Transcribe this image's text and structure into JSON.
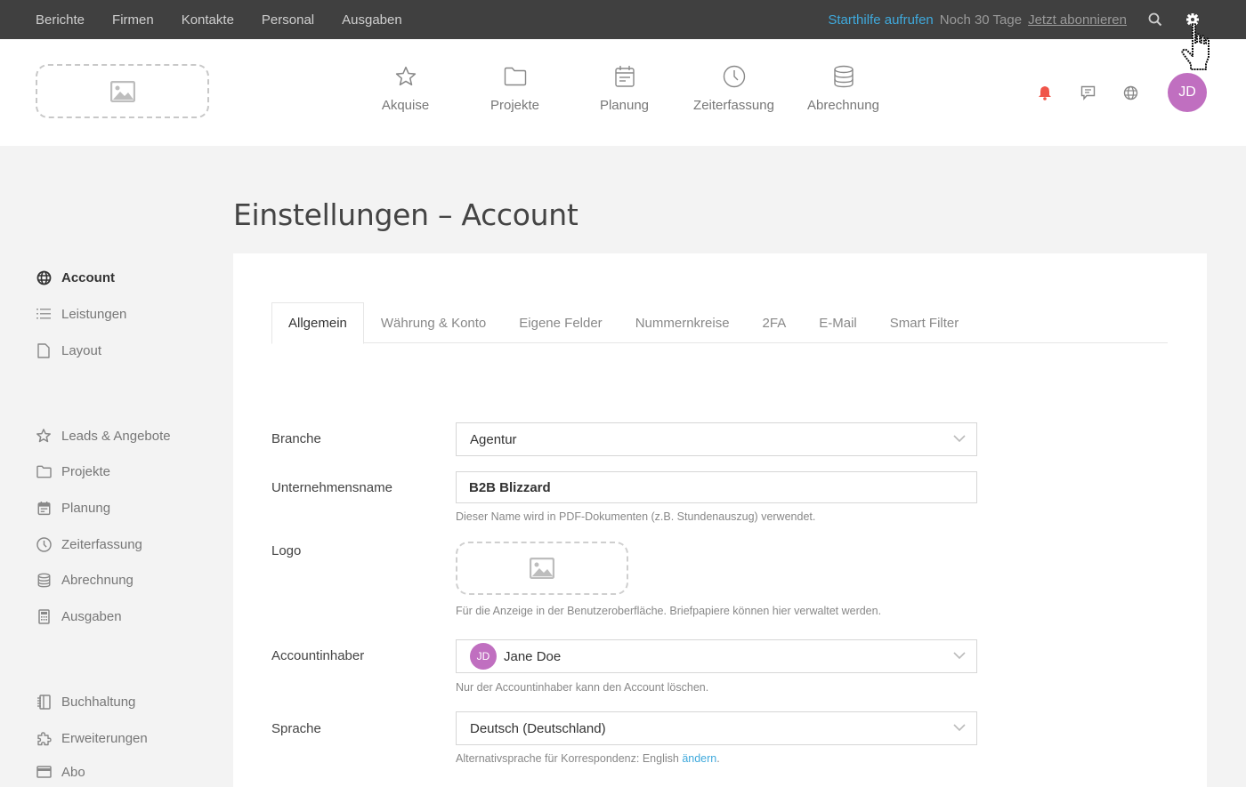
{
  "topbar": {
    "nav": [
      "Berichte",
      "Firmen",
      "Kontakte",
      "Personal",
      "Ausgaben"
    ],
    "help_link": "Starthilfe aufrufen",
    "trial_text": "Noch 30 Tage",
    "subscribe_link": "Jetzt abonnieren",
    "icons": [
      "search-icon",
      "gear-icon"
    ],
    "help_color": "#3fa9dc",
    "background": "#404040"
  },
  "header": {
    "logo_placeholder": "image-icon",
    "nav": [
      {
        "label": "Akquise",
        "icon": "star-icon"
      },
      {
        "label": "Projekte",
        "icon": "folder-icon"
      },
      {
        "label": "Planung",
        "icon": "calendar-icon"
      },
      {
        "label": "Zeiterfassung",
        "icon": "clock-icon"
      },
      {
        "label": "Abrechnung",
        "icon": "database-icon"
      }
    ],
    "icons": [
      "bell-icon",
      "chat-icon",
      "globe-icon"
    ],
    "avatar_initials": "JD",
    "avatar_color": "#c06fc0",
    "bell_color": "#f0554a"
  },
  "page": {
    "title": "Einstellungen – Account"
  },
  "sidebar": {
    "groups": [
      [
        {
          "label": "Account",
          "icon": "globe-icon",
          "active": true
        },
        {
          "label": "Leistungen",
          "icon": "list-icon"
        },
        {
          "label": "Layout",
          "icon": "document-icon"
        }
      ],
      [
        {
          "label": "Leads & Angebote",
          "icon": "star-icon"
        },
        {
          "label": "Projekte",
          "icon": "folder-icon"
        },
        {
          "label": "Planung",
          "icon": "calendar-icon"
        },
        {
          "label": "Zeiterfassung",
          "icon": "clock-icon"
        },
        {
          "label": "Abrechnung",
          "icon": "database-icon"
        },
        {
          "label": "Ausgaben",
          "icon": "calculator-icon"
        }
      ],
      [
        {
          "label": "Buchhaltung",
          "icon": "ledger-icon"
        },
        {
          "label": "Erweiterungen",
          "icon": "puzzle-icon"
        },
        {
          "label": "Abo",
          "icon": "card-icon"
        }
      ]
    ]
  },
  "tabs": [
    {
      "label": "Allgemein",
      "active": true
    },
    {
      "label": "Währung & Konto"
    },
    {
      "label": "Eigene Felder"
    },
    {
      "label": "Nummernkreise"
    },
    {
      "label": "2FA"
    },
    {
      "label": "E-Mail"
    },
    {
      "label": "Smart Filter"
    }
  ],
  "form": {
    "branche": {
      "label": "Branche",
      "value": "Agentur"
    },
    "company": {
      "label": "Unternehmensname",
      "value": "B2B Blizzard",
      "hint": "Dieser Name wird in PDF-Dokumenten (z.B. Stundenauszug) verwendet."
    },
    "logo": {
      "label": "Logo",
      "hint": "Für die Anzeige in der Benutzeroberfläche. Briefpapiere können hier verwaltet werden."
    },
    "owner": {
      "label": "Accountinhaber",
      "value": "Jane Doe",
      "initials": "JD",
      "hint": "Nur der Accountinhaber kann den Account löschen."
    },
    "language": {
      "label": "Sprache",
      "value": "Deutsch (Deutschland)",
      "hint_prefix": "Alternativsprache für Korrespondenz: English",
      "hint_link": "ändern",
      "hint_suffix": "."
    }
  }
}
